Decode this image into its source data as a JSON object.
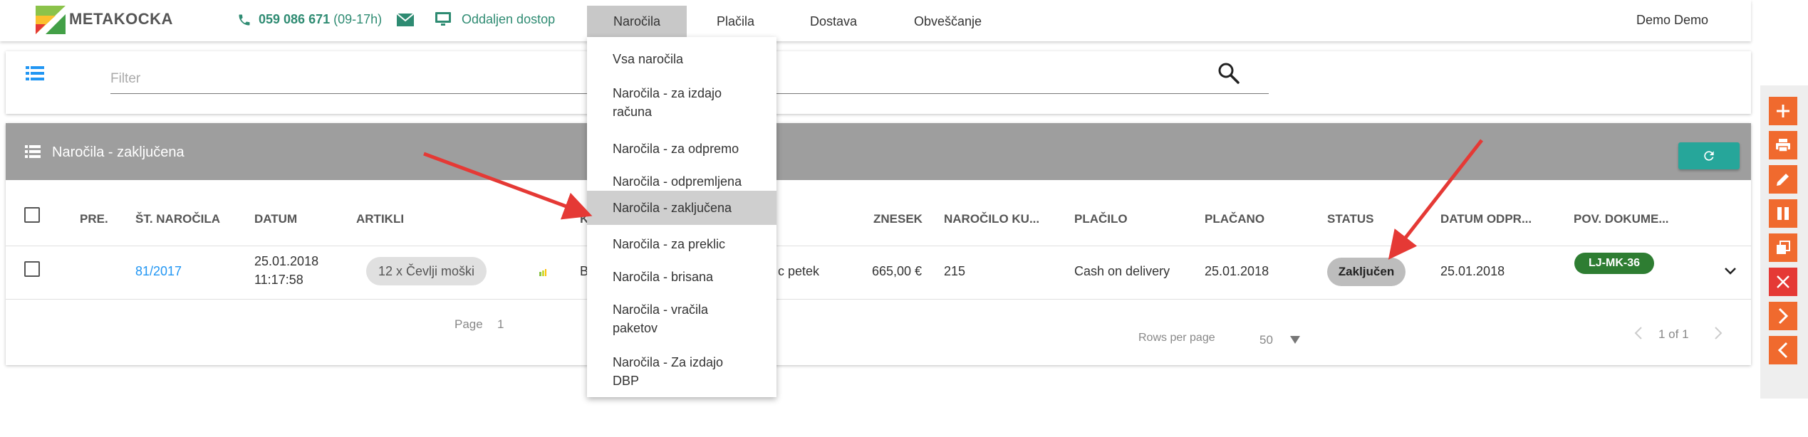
{
  "header": {
    "logo_text": "METAKOCKA",
    "phone_number": "059 086 671",
    "phone_hours": "(09-17h)",
    "remote_label": "Oddaljen dostop",
    "nav": [
      {
        "label": "Naročila",
        "active": true
      },
      {
        "label": "Plačila",
        "active": false
      },
      {
        "label": "Dostava",
        "active": false
      },
      {
        "label": "Obveščanje",
        "active": false
      }
    ],
    "user_name": "Demo Demo"
  },
  "filter": {
    "placeholder": "Filter"
  },
  "table": {
    "title": "Naročila - zaključena",
    "columns": [
      "PRE.",
      "ŠT. NAROČILA",
      "DATUM",
      "ARTIKLI",
      "K",
      "ZNESEK",
      "NAROČILO KU...",
      "PLAČILO",
      "PLAČANO",
      "STATUS",
      "DATUM ODPR...",
      "POV. DOKUME..."
    ],
    "rows": [
      {
        "pre": "",
        "order_no": "81/2017",
        "date_line1": "25.01.2018",
        "date_line2": "11:17:58",
        "articles": "12 x Čevlji moški",
        "customer_start": "B",
        "customer_end": "c petek",
        "amount": "665,00 €",
        "customer_order": "215",
        "payment": "Cash on delivery",
        "paid": "25.01.2018",
        "status": "Zaključen",
        "dispatch_date": "25.01.2018",
        "linked_doc": "LJ-MK-36"
      }
    ],
    "footer": {
      "page_label": "Page",
      "page_value": "1",
      "rows_per_page_label": "Rows per page",
      "rows_per_page_value": "50",
      "range": "1 of 1"
    }
  },
  "dropdown": {
    "items": [
      {
        "label": "Vsa naročila",
        "active": false
      },
      {
        "label": "Naročila - za izdajo računa",
        "active": false
      },
      {
        "label": "Naročila - za odpremo",
        "active": false
      },
      {
        "label": "Naročila - odpremljena",
        "active": false
      },
      {
        "label": "Naročila - zaključena",
        "active": true
      },
      {
        "label": "Naročila - za preklic",
        "active": false
      },
      {
        "label": "Naročila - brisana",
        "active": false
      },
      {
        "label": "Naročila - vračila paketov",
        "active": false
      },
      {
        "label": "Naročila - Za izdajo DBP",
        "active": false
      }
    ]
  },
  "sidebar": {
    "buttons": [
      "add-icon",
      "print-icon",
      "edit-icon",
      "pause-icon",
      "copy-icon",
      "close-icon",
      "chevron-right-icon",
      "chevron-left-icon"
    ]
  },
  "colors": {
    "accent_green": "#2e8b72",
    "header_gray": "#9e9e9e",
    "teal": "#26a69a",
    "orange": "#f06a2e",
    "red": "#e53935",
    "doc_green": "#2e7d32",
    "arrow_red": "#e53935"
  }
}
